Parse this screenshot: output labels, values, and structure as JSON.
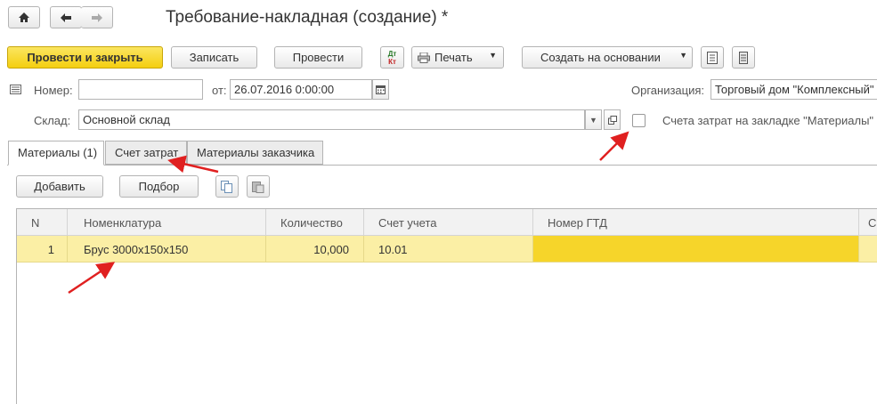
{
  "window": {
    "title": "Требование-накладная (создание) *"
  },
  "nav": {
    "home_icon": "home-icon",
    "back_icon": "arrow-left-icon",
    "forward_icon": "arrow-right-icon"
  },
  "toolbar": {
    "post_close": "Провести и закрыть",
    "save": "Записать",
    "post": "Провести",
    "dt_kt_top": "Дт",
    "dt_kt_bottom": "Кт",
    "print": "Печать",
    "create_based": "Создать на основании"
  },
  "header": {
    "number_label": "Номер:",
    "number_value": "",
    "date_label": "от:",
    "date_value": "26.07.2016  0:00:00",
    "org_label": "Организация:",
    "org_value": "Торговый дом \"Комплексный\"",
    "warehouse_label": "Склад:",
    "warehouse_value": "Основной склад",
    "checkbox_label": "Счета затрат на закладке \"Материалы\"",
    "checkbox_checked": false
  },
  "tabs": [
    {
      "label": "Материалы (1)",
      "active": true
    },
    {
      "label": "Счет затрат",
      "active": false
    },
    {
      "label": "Материалы заказчика",
      "active": false
    }
  ],
  "table_toolbar": {
    "add": "Добавить",
    "pick": "Подбор"
  },
  "table": {
    "columns": [
      "N",
      "Номенклатура",
      "Количество",
      "Счет учета",
      "Номер ГТД",
      "С"
    ],
    "rows": [
      [
        "1",
        "Брус 3000х150х150",
        "10,000",
        "10.01",
        ""
      ]
    ]
  },
  "colors": {
    "primary_button": "#f4cf10",
    "row_highlight": "#fbefa5",
    "cell_selected": "#f6d52a",
    "annotation_arrow": "#e02020"
  }
}
